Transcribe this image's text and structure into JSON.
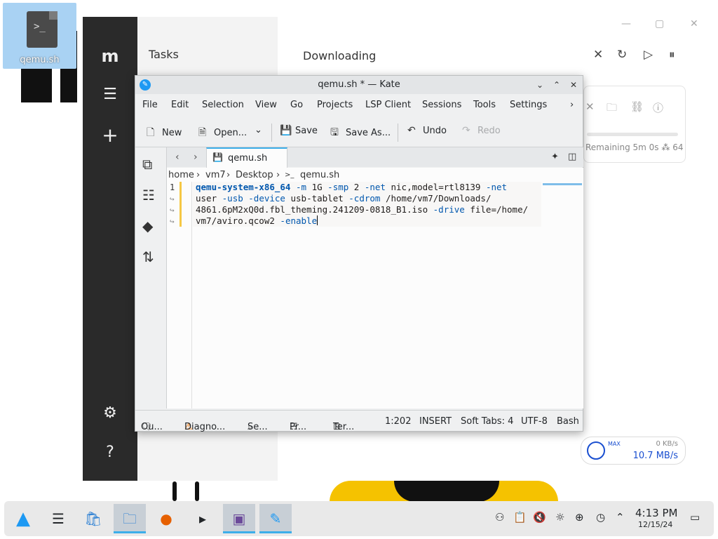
{
  "desktop": {
    "icon_label": "qemu.sh",
    "icon_glyph": ">_"
  },
  "downloader": {
    "sidebar": {
      "logo": "m",
      "menu_icon": "☰",
      "add_icon": "+",
      "settings_icon": "⚙",
      "help_icon": "?"
    },
    "panel_title": "Tasks",
    "main_title": "Downloading",
    "remaining_text": "Remaining 5m 0s",
    "count_text": "64",
    "speed": {
      "max_label": "MAX",
      "upload": "0 KB/s",
      "download": "10.7 MB/s"
    }
  },
  "kate": {
    "title": "qemu.sh * — Kate",
    "menu": [
      "File",
      "Edit",
      "Selection",
      "View",
      "Go",
      "Projects",
      "LSP Client",
      "Sessions",
      "Tools",
      "Settings"
    ],
    "toolbar": {
      "new": "New",
      "open": "Open...",
      "save": "Save",
      "save_as": "Save As...",
      "undo": "Undo",
      "redo": "Redo"
    },
    "tab": {
      "label": "qemu.sh"
    },
    "breadcrumb": [
      "home",
      "vm7",
      "Desktop",
      "qemu.sh"
    ],
    "line_number": "1",
    "code_lines": [
      {
        "cmd": "qemu-system-x86_64",
        "rest": " -m 1G -smp 2 -net nic,model=rtl8139 -net"
      },
      {
        "cmd": "",
        "rest": "user -usb -device usb-tablet -cdrom /home/vm7/Downloads/"
      },
      {
        "cmd": "",
        "rest": "4861.6pM2xQ0d.fbl_theming.241209-0818_B1.iso -drive file=/home/"
      },
      {
        "cmd": "",
        "rest": "vm7/aviro.qcow2 -enable"
      }
    ],
    "status": {
      "output": "Ou...",
      "diagnostics": "Diagno...",
      "search": "Se...",
      "projects": "Pr...",
      "terminal": "Ter...",
      "position": "1:202",
      "mode": "INSERT",
      "tabs": "Soft Tabs: 4",
      "encoding": "UTF-8",
      "language": "Bash"
    }
  },
  "taskbar": {
    "time": "4:13 PM",
    "date": "12/15/24"
  }
}
